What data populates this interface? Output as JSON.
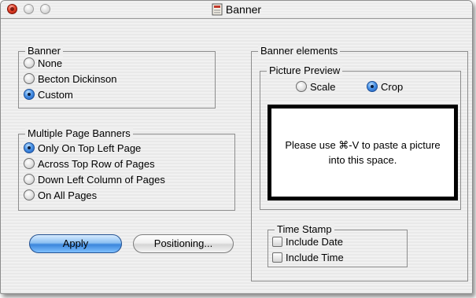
{
  "window": {
    "title": "Banner"
  },
  "banner_group": {
    "title": "Banner",
    "options": [
      "None",
      "Becton Dickinson",
      "Custom"
    ],
    "selected": "Custom"
  },
  "multi_group": {
    "title": "Multiple Page Banners",
    "options": [
      "Only On Top Left Page",
      "Across Top Row of Pages",
      "Down Left Column of Pages",
      "On All Pages"
    ],
    "selected": "Only On Top Left Page"
  },
  "buttons": {
    "apply": "Apply",
    "positioning": "Positioning..."
  },
  "elements_group": {
    "title": "Banner elements"
  },
  "preview_group": {
    "title": "Picture Preview",
    "scale": "Scale",
    "crop": "Crop",
    "selected": "Crop",
    "placeholder": "Please use ⌘-V to paste a picture into this space."
  },
  "timestamp_group": {
    "title": "Time Stamp",
    "include_date": "Include Date",
    "include_time": "Include Time"
  },
  "colors": {
    "default_button": "#3b86dc",
    "close_button": "#e2442c"
  }
}
